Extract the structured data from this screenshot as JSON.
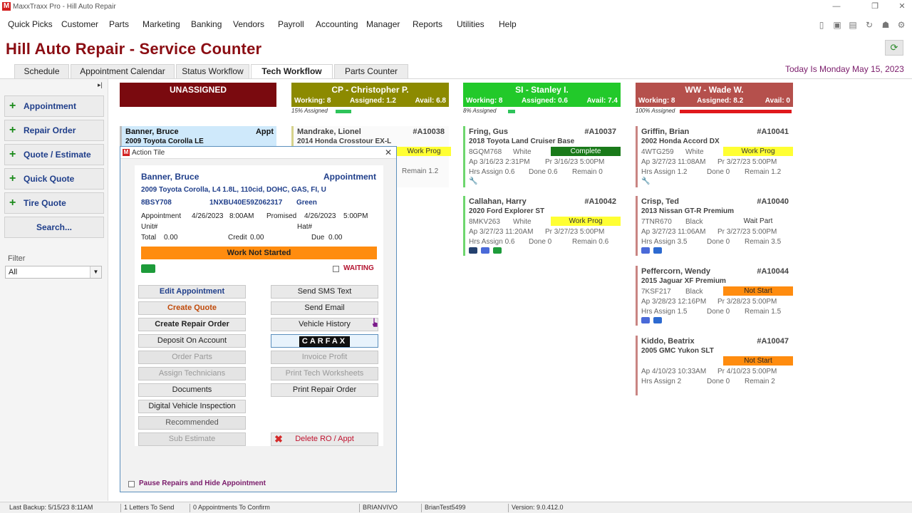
{
  "window": {
    "title": "MaxxTraxx Pro - Hill Auto Repair"
  },
  "menu": [
    "Quick Picks",
    "Customer",
    "Parts",
    "Marketing",
    "Banking",
    "Vendors",
    "Payroll",
    "Accounting",
    "Manager",
    "Reports",
    "Utilities",
    "Help"
  ],
  "app": {
    "title": "Hill Auto Repair - Service Counter",
    "today": "Today Is Monday May 15, 2023"
  },
  "tabs": [
    "Schedule",
    "Appointment Calendar",
    "Status Workflow",
    "Tech Workflow",
    "Parts Counter"
  ],
  "left": {
    "buttons": [
      "Appointment",
      "Repair Order",
      "Quote / Estimate",
      "Quick Quote",
      "Tire Quote"
    ],
    "search": "Search...",
    "filter_label": "Filter",
    "filter_value": "All"
  },
  "columns": [
    {
      "name": "UNASSIGNED",
      "color": "#7a0a0f"
    },
    {
      "name": "CP - Christopher P.",
      "working": "Working: 8",
      "assigned": "Assigned: 1.2",
      "avail": "Avail: 6.8",
      "pct": "15% Assigned",
      "pct_value": 15,
      "color": "#8c8a00",
      "barcolor": "#2ec45a"
    },
    {
      "name": "SI - Stanley I.",
      "working": "Working: 8",
      "assigned": "Assigned: 0.6",
      "avail": "Avail: 7.4",
      "pct": "8% Assigned",
      "pct_value": 8,
      "color": "#22c92a",
      "barcolor": "#2ec45a"
    },
    {
      "name": "WW - Wade W.",
      "working": "Working: 8",
      "assigned": "Assigned: 8.2",
      "avail": "Avail: 0",
      "pct": "100% Assigned",
      "pct_value": 100,
      "color": "#b5504c",
      "barcolor": "#e0181c"
    }
  ],
  "cards": {
    "unassigned": {
      "name": "Banner, Bruce",
      "type": "Appt",
      "vehicle": "2009 Toyota Corolla LE"
    },
    "cp1": {
      "name": "Mandrake, Lionel",
      "num": "#A10038",
      "vehicle": "2014 Honda Crosstour EX-L",
      "status": "Work Prog",
      "remain": "Remain 1.2"
    },
    "si1": {
      "name": "Fring, Gus",
      "num": "#A10037",
      "vehicle": "2018 Toyota Land Cruiser Base",
      "plate": "8GQM768",
      "color": "White",
      "status": "Complete",
      "ap": "Ap 3/16/23 2:31PM",
      "pr": "Pr 3/16/23 5:00PM",
      "hrs": "Hrs Assign 0.6",
      "done": "Done 0.6",
      "remain": "Remain 0"
    },
    "si2": {
      "name": "Callahan, Harry",
      "num": "#A10042",
      "vehicle": "2020 Ford Explorer ST",
      "plate": "8MKV263",
      "color": "White",
      "status": "Work Prog",
      "ap": "Ap 3/27/23 11:20AM",
      "pr": "Pr 3/27/23 5:00PM",
      "hrs": "Hrs Assign 0.6",
      "done": "Done 0",
      "remain": "Remain 0.6"
    },
    "ww1": {
      "name": "Griffin, Brian",
      "num": "#A10041",
      "vehicle": "2002 Honda Accord DX",
      "plate": "4WTG259",
      "color": "White",
      "status": "Work Prog",
      "ap": "Ap 3/27/23 11:08AM",
      "pr": "Pr 3/27/23 5:00PM",
      "hrs": "Hrs Assign 1.2",
      "done": "Done 0",
      "remain": "Remain 1.2"
    },
    "ww2": {
      "name": "Crisp, Ted",
      "num": "#A10040",
      "vehicle": "2013 Nissan GT-R Premium",
      "plate": "7TNR670",
      "color": "Black",
      "status": "Wait Part",
      "ap": "Ap 3/27/23 11:06AM",
      "pr": "Pr 3/27/23 5:00PM",
      "hrs": "Hrs Assign 3.5",
      "done": "Done 0",
      "remain": "Remain 3.5"
    },
    "ww3": {
      "name": "Peffercorn, Wendy",
      "num": "#A10044",
      "vehicle": "2015 Jaguar XF Premium",
      "plate": "7KSF217",
      "color": "Black",
      "status": "Not Start",
      "ap": "Ap 3/28/23 12:16PM",
      "pr": "Pr 3/28/23 5:00PM",
      "hrs": "Hrs Assign 1.5",
      "done": "Done 0",
      "remain": "Remain 1.5"
    },
    "ww4": {
      "name": "Kiddo, Beatrix",
      "num": "#A10047",
      "vehicle": "2005 GMC Yukon SLT",
      "status": "Not Start",
      "ap": "Ap 4/10/23 10:33AM",
      "pr": "Pr 4/10/23 5:00PM",
      "hrs": "Hrs Assign 2",
      "done": "Done 0",
      "remain": "Remain 2"
    }
  },
  "modal": {
    "title": "Action Tile",
    "customer": "Banner, Bruce",
    "type": "Appointment",
    "vehicle": "2009 Toyota  Corolla, L4 1.8L, 110cid, DOHC, GAS, FI, U",
    "plate": "8BSY708",
    "vin": "1NXBU40E59Z062317",
    "color": "Green",
    "appt_label": "Appointment",
    "appt_date": "4/26/2023",
    "appt_time": "8:00AM",
    "promised_label": "Promised",
    "promised_date": "4/26/2023",
    "promised_time": "5:00PM",
    "unit": "Unit#",
    "hat": "Hat#",
    "total_label": "Total",
    "total": "0.00",
    "credit_label": "Credit",
    "credit": "0.00",
    "due_label": "Due",
    "due": "0.00",
    "status": "Work Not Started",
    "waiting": "WAITING",
    "left_buttons": [
      "Edit Appointment",
      "Create Quote",
      "Create Repair Order",
      "Deposit On Account",
      "Order Parts",
      "Assign Technicians",
      "Documents",
      "Digital Vehicle Inspection",
      "Recommended",
      "Sub Estimate"
    ],
    "right_buttons": [
      "Send SMS Text",
      "Send Email",
      "Vehicle History",
      "CARFAX",
      "Invoice Profit",
      "Print Tech Worksheets",
      "Print Repair Order"
    ],
    "delete": "Delete RO / Appt",
    "pause": "Pause Repairs and Hide Appointment"
  },
  "status": {
    "backup": "Last Backup:  5/15/23   8:11AM",
    "letters": "1 Letters To Send",
    "confirm": "0 Appointments To Confirm",
    "machine": "BRIANVIVO",
    "user": "BrianTest5499",
    "version": "Version:  9.0.412.0"
  },
  "colors": {
    "brand": "#8b0d13",
    "work_prog": "#ffff33",
    "complete": "#1a7a1a",
    "not_start": "#ff8c0f",
    "work_not_started": "#ff8c0f"
  }
}
